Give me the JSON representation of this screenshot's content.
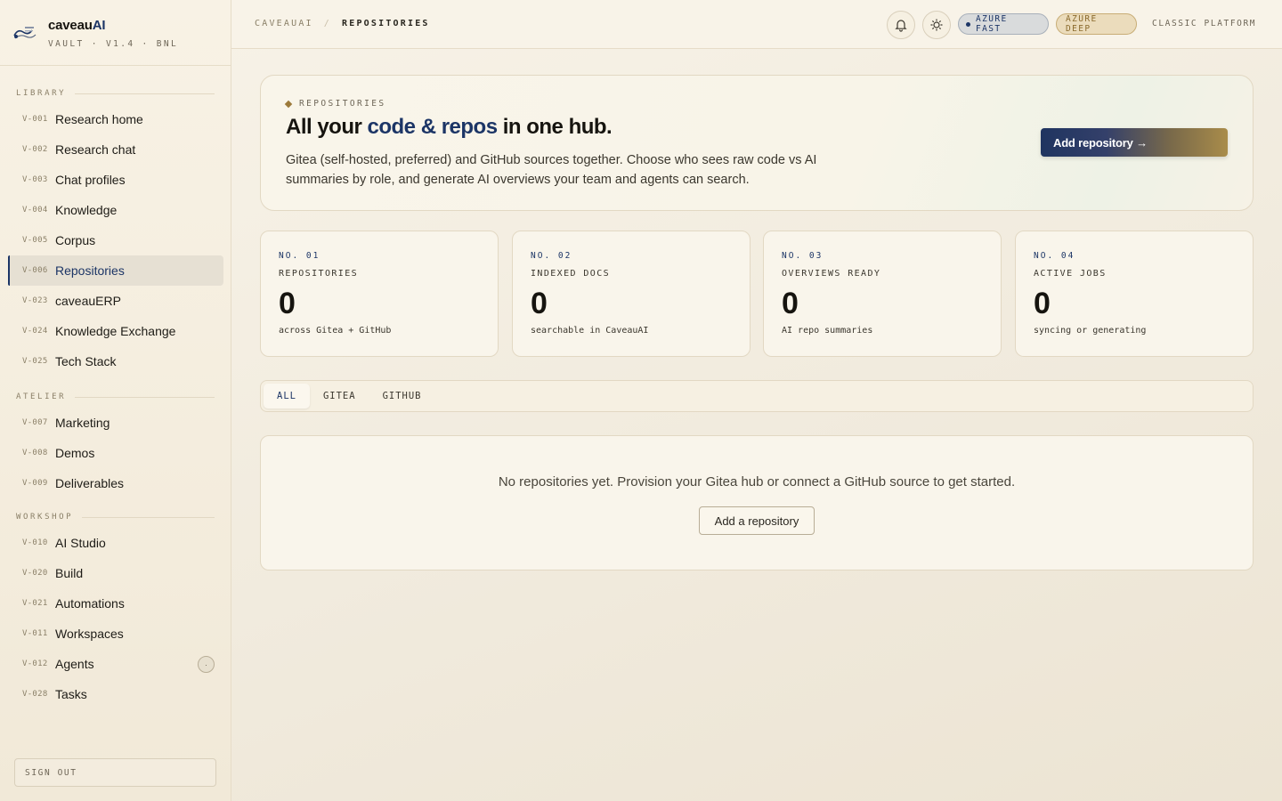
{
  "brand": {
    "name_prefix": "caveau",
    "name_suffix": "AI",
    "subtitle": "VAULT · V1.4 · BNL"
  },
  "sidebar": {
    "sections": [
      {
        "label": "LIBRARY",
        "items": [
          {
            "code": "V-001",
            "label": "Research home"
          },
          {
            "code": "V-002",
            "label": "Research chat"
          },
          {
            "code": "V-003",
            "label": "Chat profiles"
          },
          {
            "code": "V-004",
            "label": "Knowledge"
          },
          {
            "code": "V-005",
            "label": "Corpus"
          },
          {
            "code": "V-006",
            "label": "Repositories",
            "active": true
          },
          {
            "code": "V-023",
            "label": "caveauERP"
          },
          {
            "code": "V-024",
            "label": "Knowledge Exchange"
          },
          {
            "code": "V-025",
            "label": "Tech Stack"
          }
        ]
      },
      {
        "label": "ATELIER",
        "items": [
          {
            "code": "V-007",
            "label": "Marketing"
          },
          {
            "code": "V-008",
            "label": "Demos"
          },
          {
            "code": "V-009",
            "label": "Deliverables"
          }
        ]
      },
      {
        "label": "WORKSHOP",
        "items": [
          {
            "code": "V-010",
            "label": "AI Studio"
          },
          {
            "code": "V-020",
            "label": "Build"
          },
          {
            "code": "V-021",
            "label": "Automations"
          },
          {
            "code": "V-011",
            "label": "Workspaces"
          },
          {
            "code": "V-012",
            "label": "Agents",
            "badge": "·"
          },
          {
            "code": "V-028",
            "label": "Tasks"
          }
        ]
      }
    ],
    "signout_label": "SIGN OUT"
  },
  "topbar": {
    "breadcrumb_root": "CAVEAUAI",
    "breadcrumb_sep": "/",
    "breadcrumb_current": "REPOSITORIES",
    "bell_icon": "bell-icon",
    "theme_icon": "sun-icon",
    "model_fast": "AZURE FAST",
    "model_deep": "AZURE DEEP",
    "classic_link": "CLASSIC PLATFORM"
  },
  "hero": {
    "tag": "REPOSITORIES",
    "title_pre": "All your ",
    "title_highlight": "code & repos",
    "title_post": " in one hub.",
    "description": "Gitea (self-hosted, preferred) and GitHub sources together. Choose who sees raw code vs AI summaries by role, and generate AI overviews your team and agents can search.",
    "button": "Add repository →"
  },
  "stats": [
    {
      "no": "NO. 01",
      "label": "REPOSITORIES",
      "value": "0",
      "sub": "across Gitea + GitHub"
    },
    {
      "no": "NO. 02",
      "label": "INDEXED DOCS",
      "value": "0",
      "sub": "searchable in CaveauAI"
    },
    {
      "no": "NO. 03",
      "label": "OVERVIEWS READY",
      "value": "0",
      "sub": "AI repo summaries"
    },
    {
      "no": "NO. 04",
      "label": "ACTIVE JOBS",
      "value": "0",
      "sub": "syncing or generating"
    }
  ],
  "filters": {
    "tabs": [
      "ALL",
      "GITEA",
      "GITHUB"
    ],
    "active": "ALL"
  },
  "empty_state": {
    "message": "No repositories yet. Provision your Gitea hub or connect a GitHub source to get started.",
    "button": "Add a repository"
  },
  "colors": {
    "accent": "#1c3566",
    "gold": "#9c7a3a",
    "background": "#f3ede0"
  }
}
